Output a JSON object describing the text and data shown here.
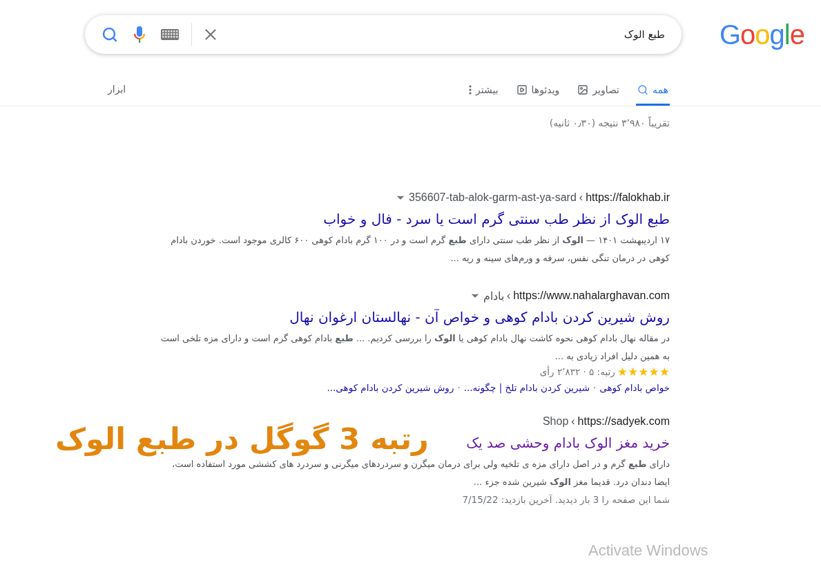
{
  "logo": "Google",
  "search": {
    "value": "طبع الوک"
  },
  "tabs": [
    {
      "label": "همه",
      "kind": "search",
      "selected": true
    },
    {
      "label": "تصاویر",
      "kind": "images",
      "selected": false
    },
    {
      "label": "ویدئوها",
      "kind": "videos",
      "selected": false
    },
    {
      "label": "بیشتر",
      "kind": "more",
      "selected": false
    }
  ],
  "tools": "ابزار",
  "result_stats": "تقریباً ۳٬۹۸۰ نتیجه (۰٫۳۰ ثانیه)",
  "results": [
    {
      "domain": "https://falokhab.ir",
      "separator": "‹",
      "path": "356607-tab-alok-garm-ast-ya-sard",
      "title": "طبع الوک از نظر طب سنتی گرم است یا سرد - فال و خواب",
      "visited": false,
      "snippet": "۱۷ اردیبهشت ۱۴۰۱ — **الوک** از نظر طب سنتی دارای **طبع** گرم است و در ۱۰۰ گرم بادام کوهی ۶۰۰ کالری موجود است. خوردن بادام کوهی در درمان تنگی نفس، سرفه و ورم‌های سینه و ریه ..."
    },
    {
      "domain": "https://www.nahalarghavan.com",
      "separator": "‹",
      "path": "بادام",
      "title": "روش شیرین کردن بادام کوهی و خواص آن - نهالستان ارغوان نهال",
      "visited": false,
      "snippet": "در مقاله نهال بادام کوهی نحوه کاشت نهال بادام کوهی یا **الوک** را بررسی کردیم. ... **طبع** بادام کوهی گرم است و دارای مزه تلخی است به همین دلیل افراد زیادی به ...",
      "rating": {
        "stars": 5,
        "text": "رتبه: ۵ · ۲٬۸۳۲ رأی"
      },
      "sitelinks": {
        "separator": "·",
        "links": [
          "خواص بادام کوهی",
          "شیرین کردن بادام تلخ | چگونه...",
          "روش شیرین کردن بادام کوهی..."
        ]
      }
    },
    {
      "domain": "https://sadyek.com",
      "separator": "‹",
      "path": "Shop",
      "title": "خرید مغز الوک بادام وحشی صد یک",
      "visited": true,
      "snippet": "دارای **طبع** گرم و در اصل دارای مزه ی تلخیه ولی برای درمان میگرن و سردردهای میگرنی و سردرد های کششی مورد استفاده است، ایضا دندان درد. قدیما مغز **الوک** شیرین شده جزء ...",
      "visit_note": "شما این صفحه را 3 بار دیدید. آخرین بازدید: 7/15/22"
    }
  ],
  "annotation": "رتبه 3 گوگل در طبع الوک",
  "os_notice": "Activate Windows"
}
